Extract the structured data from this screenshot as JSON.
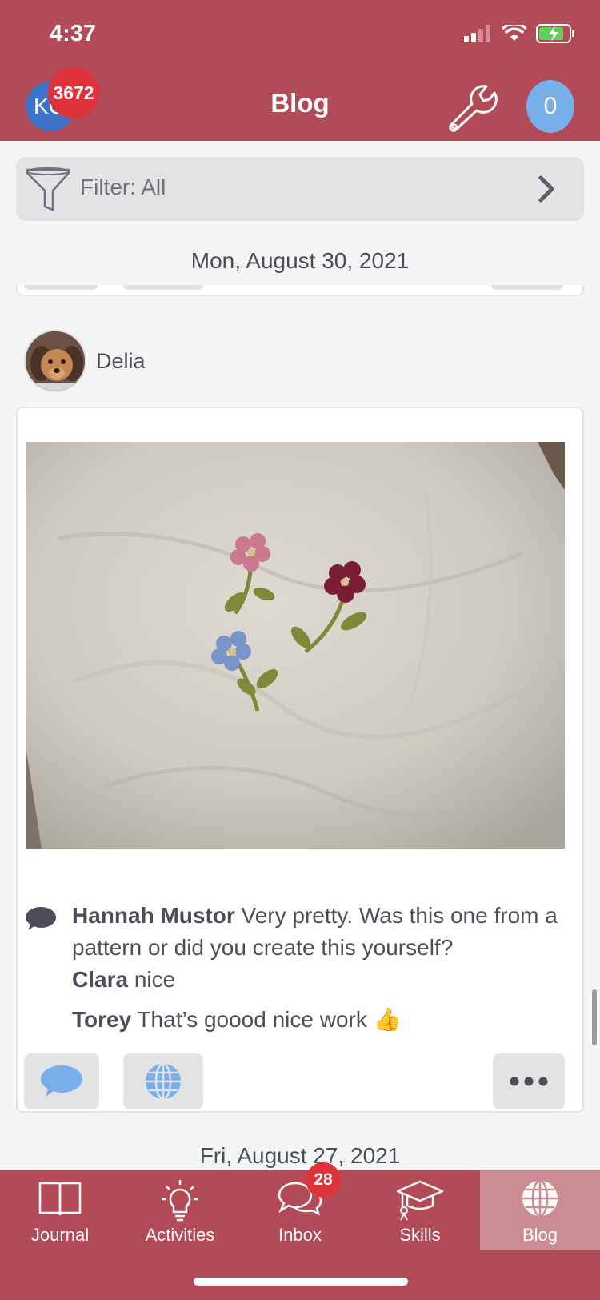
{
  "status_bar": {
    "time": "4:37"
  },
  "header": {
    "user_initials": "KC",
    "notification_count": "3672",
    "title": "Blog",
    "points": "0"
  },
  "filter": {
    "label": "Filter: All"
  },
  "feed": {
    "dates": [
      "Mon, August 30, 2021",
      "Fri, August 27, 2021"
    ],
    "post": {
      "author": "Delia",
      "photo_icon": "embroidered-flowers-photo",
      "comments": [
        {
          "name": "Hannah Mustor",
          "text": " Very pretty.  Was this one from a pattern or did you create this yourself?"
        },
        {
          "name": "Clara",
          "text": " nice"
        },
        {
          "name": "Torey",
          "text": " That’s goood nice work 👍"
        }
      ]
    }
  },
  "tabbar": {
    "tabs": [
      {
        "label": "Journal",
        "icon": "book-icon"
      },
      {
        "label": "Activities",
        "icon": "lightbulb-icon"
      },
      {
        "label": "Inbox",
        "icon": "chat-bubbles-icon"
      },
      {
        "label": "Skills",
        "icon": "graduation-cap-icon"
      },
      {
        "label": "Blog",
        "icon": "globe-icon"
      }
    ],
    "inbox_badge": "28",
    "active": "Blog"
  },
  "colors": {
    "brand": "#b24a57",
    "active_tab": "#cc8c93",
    "badge": "#e0323a",
    "accent_blue": "#78aeea"
  }
}
